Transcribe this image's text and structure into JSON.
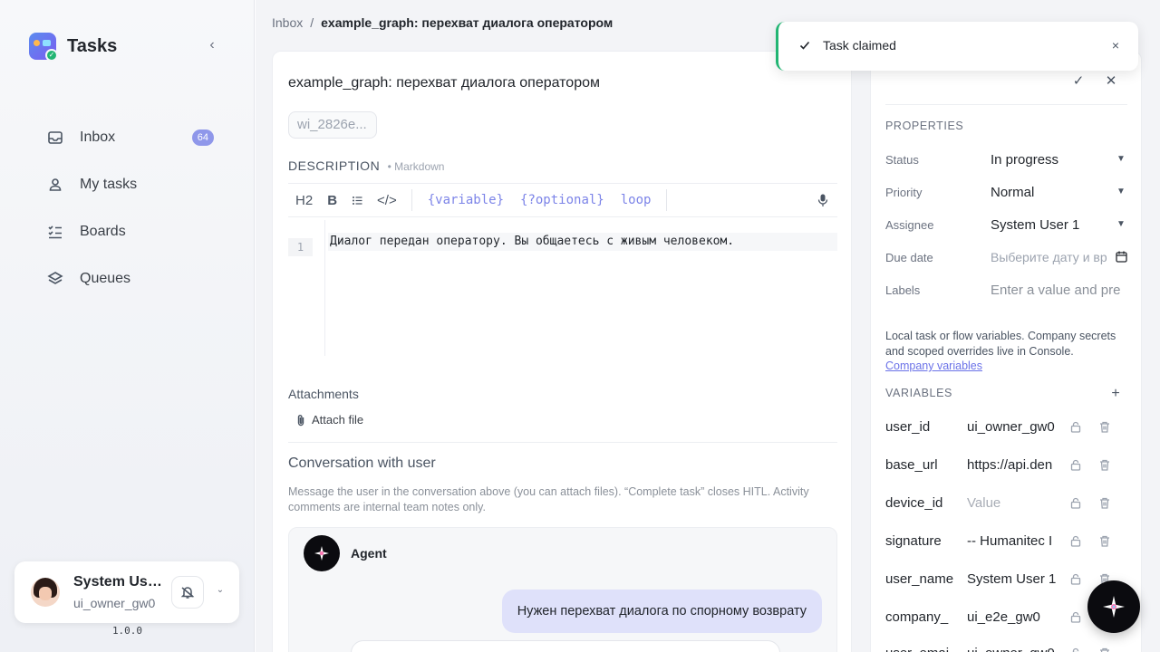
{
  "app": {
    "title": "Tasks",
    "version": "1.0.0"
  },
  "sidebar": {
    "items": [
      {
        "label": "Inbox",
        "icon": "inbox-icon",
        "badge": "64"
      },
      {
        "label": "My tasks",
        "icon": "user-icon"
      },
      {
        "label": "Boards",
        "icon": "checklist-icon"
      },
      {
        "label": "Queues",
        "icon": "layers-icon"
      }
    ],
    "user": {
      "name": "System User 1",
      "id": "ui_owner_gw0"
    }
  },
  "breadcrumb": {
    "root": "Inbox",
    "separator": "/",
    "current": "example_graph: перехват диалога оператором"
  },
  "task": {
    "title": "example_graph: перехват диалога оператором",
    "id_chip": "wi_2826e...",
    "description_label": "DESCRIPTION",
    "description_note": "• Markdown",
    "toolbar": {
      "h2": "H2",
      "bold": "B",
      "list": "☷",
      "code": "</>",
      "var1": "{variable}",
      "var2": "{?optional}",
      "var3": "loop"
    },
    "line_number": "1",
    "code_line": "Диалог передан оператору. Вы общаетесь с живым человеком.",
    "attachments_label": "Attachments",
    "attach_button": "Attach file",
    "conversation_title": "Conversation with user",
    "conversation_hint": "Message the user in the conversation above (you can attach files). “Complete task” closes HITL. Activity comments are internal team notes only.",
    "agent_name": "Agent",
    "message": "Нужен перехват диалога по спорному возврату"
  },
  "panel": {
    "properties_title": "PROPERTIES",
    "properties": [
      {
        "label": "Status",
        "value": "In progress",
        "type": "select"
      },
      {
        "label": "Priority",
        "value": "Normal",
        "type": "select"
      },
      {
        "label": "Assignee",
        "value": "System User 1",
        "type": "select"
      },
      {
        "label": "Due date",
        "placeholder": "Выберите дату и вр",
        "type": "date"
      },
      {
        "label": "Labels",
        "placeholder": "Enter a value and pre",
        "type": "text"
      }
    ],
    "variables_note": "Local task or flow variables. Company secrets and scoped overrides live in Console.",
    "variables_link": "Company variables",
    "variables_title": "VARIABLES",
    "variables": [
      {
        "key": "user_id",
        "value": "ui_owner_gw0"
      },
      {
        "key": "base_url",
        "value": "https://api.den"
      },
      {
        "key": "device_id",
        "placeholder": "Value"
      },
      {
        "key": "signature",
        "value": "-- Humanitec I"
      },
      {
        "key": "user_name",
        "value": "System User 1"
      },
      {
        "key": "company_",
        "value": "ui_e2e_gw0"
      },
      {
        "key": "user_emai",
        "value": "ui_owner_gw0"
      }
    ]
  },
  "toast": {
    "message": "Task claimed"
  },
  "colors": {
    "accent": "#7c84e8",
    "badge": "#8f97ea",
    "success": "#22b573"
  }
}
